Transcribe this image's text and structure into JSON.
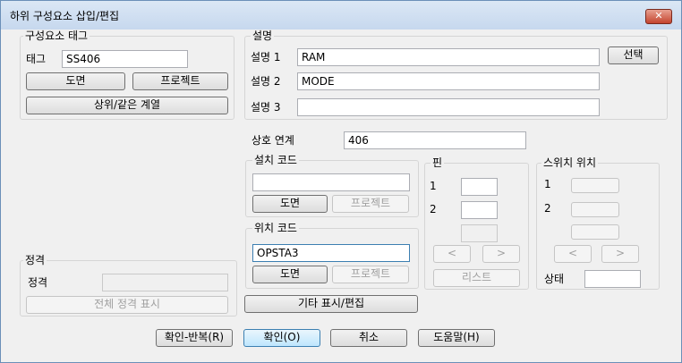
{
  "window": {
    "title": "하위 구성요소 삽입/편집",
    "close_symbol": "✕"
  },
  "component_tag": {
    "group_label": "구성요소 태그",
    "tag_label": "태그",
    "tag_value": "SS406",
    "drawing_button": "도면",
    "project_button": "프로젝트",
    "parent_sibling_button": "상위/같은 계열"
  },
  "description": {
    "group_label": "설명",
    "line1_label": "설명 1",
    "line1_value": "RAM",
    "line2_label": "설명 2",
    "line2_value": "MODE",
    "line3_label": "설명 3",
    "line3_value": "",
    "select_button": "선택"
  },
  "cross_reference": {
    "label": "상호 연계",
    "value": "406"
  },
  "install_code": {
    "group_label": "설치 코드",
    "value": "",
    "drawing_button": "도면",
    "project_button": "프로젝트"
  },
  "location_code": {
    "group_label": "위치 코드",
    "value": "OPSTA3",
    "drawing_button": "도면",
    "project_button": "프로젝트"
  },
  "pins": {
    "group_label": "핀",
    "pin1_label": "1",
    "pin2_label": "2",
    "prev_symbol": "<",
    "next_symbol": ">",
    "list_button": "리스트"
  },
  "switch_position": {
    "group_label": "스위치 위치",
    "pos1_label": "1",
    "pos2_label": "2",
    "prev_symbol": "<",
    "next_symbol": ">",
    "state_label": "상태"
  },
  "rating": {
    "group_label": "정격",
    "rating_label": "정격",
    "show_all_button": "전체 정격 표시"
  },
  "other_display_edit_button": "기타 표시/편집",
  "footer": {
    "ok_repeat": "확인-반복(R)",
    "ok": "확인(O)",
    "cancel": "취소",
    "help": "도움말(H)"
  }
}
